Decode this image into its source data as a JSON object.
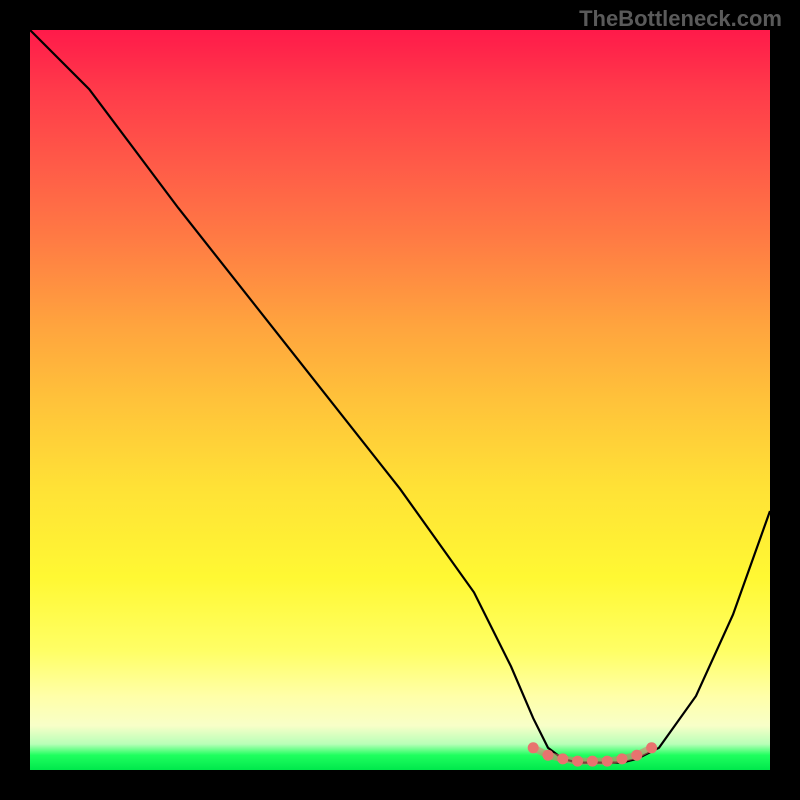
{
  "watermark": "TheBottleneck.com",
  "chart_data": {
    "type": "line",
    "title": "",
    "xlabel": "",
    "ylabel": "",
    "xlim": [
      0,
      100
    ],
    "ylim": [
      0,
      100
    ],
    "series": [
      {
        "name": "bottleneck-curve",
        "x": [
          0,
          8,
          20,
          35,
          50,
          60,
          65,
          68,
          70,
          72,
          74,
          76,
          78,
          80,
          82,
          85,
          90,
          95,
          100
        ],
        "y": [
          100,
          92,
          76,
          57,
          38,
          24,
          14,
          7,
          3,
          1.5,
          1,
          1,
          1,
          1,
          1.5,
          3,
          10,
          21,
          35
        ]
      }
    ],
    "highlight": {
      "name": "optimal-range",
      "x": [
        68,
        70,
        72,
        74,
        76,
        78,
        80,
        82,
        84
      ],
      "y": [
        3,
        2,
        1.5,
        1.2,
        1.2,
        1.2,
        1.5,
        2,
        3
      ]
    },
    "grid": false,
    "colors": {
      "curve": "#000000",
      "highlight": "#e8736f",
      "gradient_top": "#ff1a4a",
      "gradient_mid": "#ffe236",
      "gradient_bottom": "#00e84c"
    }
  }
}
